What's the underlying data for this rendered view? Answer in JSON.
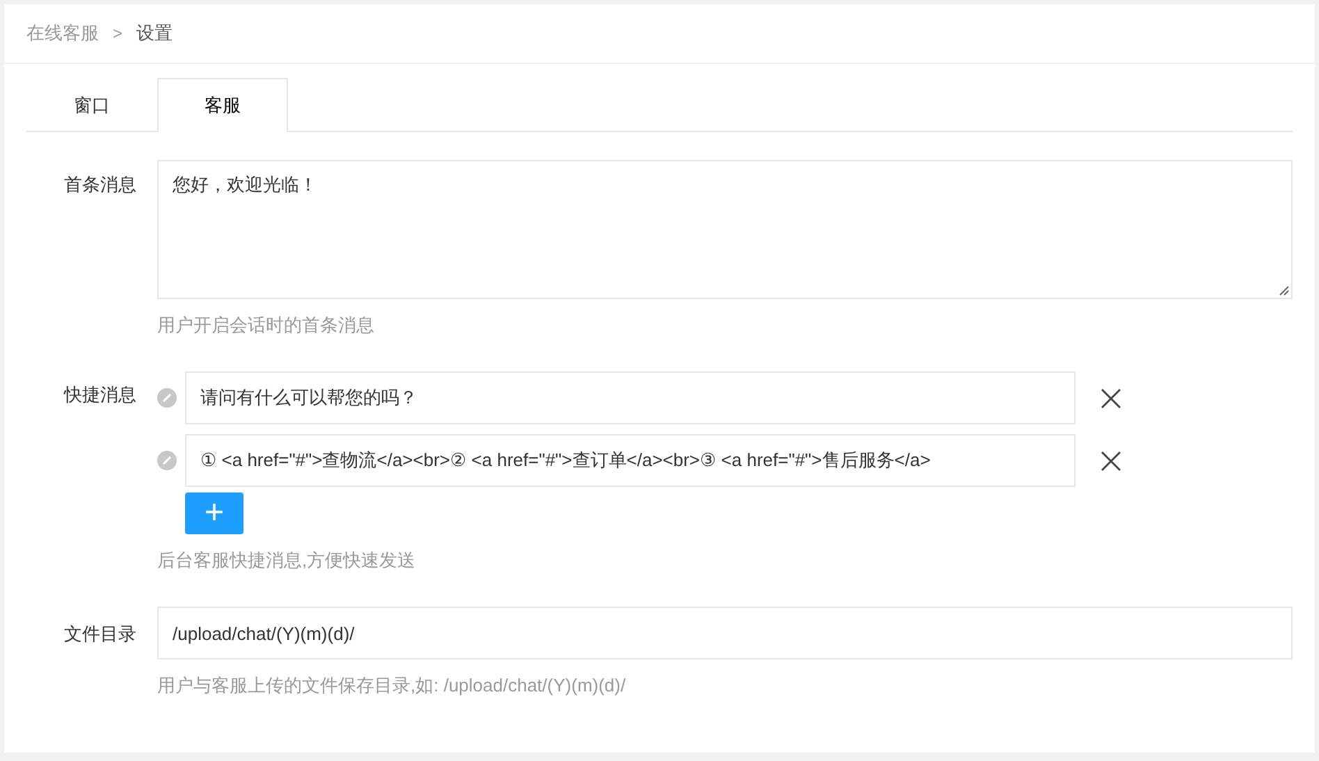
{
  "breadcrumb": {
    "items": [
      {
        "label": "在线客服",
        "selected": false
      },
      {
        "label": "设置",
        "selected": true
      }
    ],
    "separator": ">"
  },
  "tabs": [
    {
      "label": "窗口",
      "selected": false
    },
    {
      "label": "客服",
      "selected": true
    }
  ],
  "fields": [
    {
      "kind": "textarea",
      "label": "首条消息",
      "value": "您好，欢迎光临！",
      "help": "用户开启会话时的首条消息"
    },
    {
      "kind": "list",
      "label": "快捷消息",
      "items": [
        {
          "value": "请问有什么可以帮您的吗？"
        },
        {
          "value": "① <a href=\"#\">查物流</a><br>② <a href=\"#\">查订单</a><br>③ <a href=\"#\">售后服务</a>"
        }
      ],
      "add_button": "+",
      "help": "后台客服快捷消息,方便快速发送"
    },
    {
      "kind": "input",
      "label": "文件目录",
      "value": "/upload/chat/(Y)(m)(d)/",
      "help": "用户与客服上传的文件保存目录,如: /upload/chat/(Y)(m)(d)/"
    }
  ]
}
